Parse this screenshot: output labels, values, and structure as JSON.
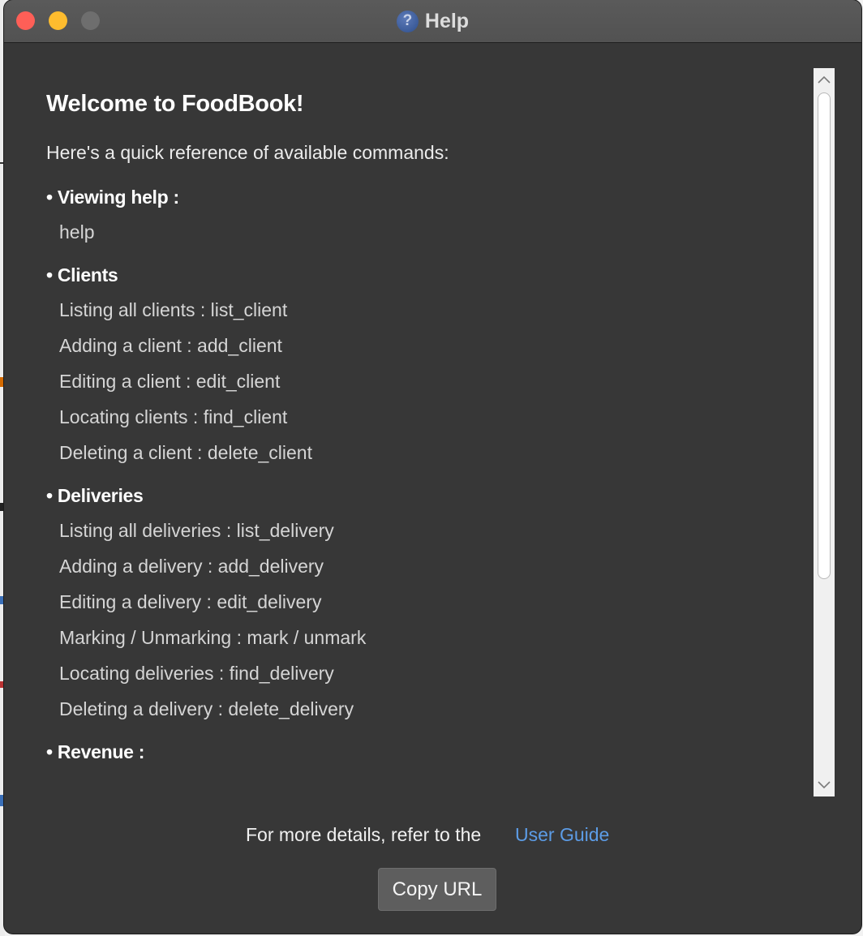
{
  "window": {
    "title": "Help"
  },
  "content": {
    "heading": "Welcome to FoodBook!",
    "intro": "Here's a quick reference of available commands:",
    "sections": [
      {
        "title": "• Viewing help :",
        "commands": [
          "help"
        ]
      },
      {
        "title": "• Clients",
        "commands": [
          "Listing all clients : list_client",
          "Adding a client : add_client",
          "Editing a client : edit_client",
          "Locating clients : find_client",
          "Deleting a client : delete_client"
        ]
      },
      {
        "title": "• Deliveries",
        "commands": [
          "Listing all deliveries : list_delivery",
          "Adding a delivery : add_delivery",
          "Editing a delivery : edit_delivery",
          "Marking / Unmarking : mark / unmark",
          "Locating deliveries : find_delivery",
          "Deleting a delivery : delete_delivery"
        ]
      },
      {
        "title": "• Revenue :",
        "commands": []
      }
    ]
  },
  "footer": {
    "text": "For more details, refer to the",
    "link": "User Guide",
    "copy_button": "Copy URL"
  },
  "colors": {
    "background": "#373737",
    "link": "#5c9ce6",
    "button": "#5e5e5e"
  },
  "icons": {
    "title": "question-mark-circle-icon",
    "scroll_up": "chevron-up-icon",
    "scroll_down": "chevron-down-icon"
  }
}
